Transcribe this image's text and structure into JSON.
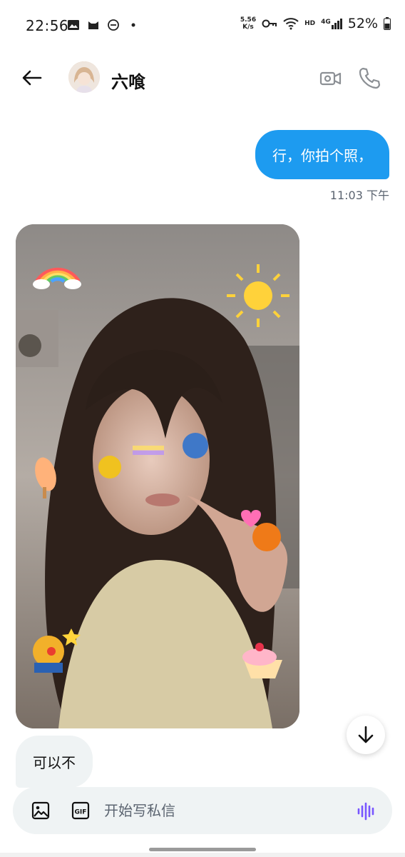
{
  "status_bar": {
    "time": "22:56",
    "net_speed_value": "5.56",
    "net_speed_unit": "K/s",
    "network_hd": "HD",
    "network_gen": "4G",
    "battery": "52%",
    "left_icons": [
      "image-icon",
      "cat-icon",
      "dnd-icon",
      "dot-icon"
    ],
    "right_icons": [
      "key-icon",
      "wifi-icon",
      "signal-icon",
      "battery-icon"
    ]
  },
  "header": {
    "contact_name": "六喰",
    "icons": [
      "back-arrow-icon",
      "video-call-icon",
      "phone-icon"
    ]
  },
  "conversation": {
    "outgoing_message": "行，你拍个照，",
    "outgoing_time": "11:03 下午",
    "incoming_message": "可以不"
  },
  "composer": {
    "placeholder": "开始写私信",
    "icons": [
      "image-icon",
      "gif-icon",
      "voice-icon"
    ],
    "gif_label": "GIF"
  },
  "colors": {
    "accent": "#1d9bf0",
    "incoming_bubble": "#eff3f4",
    "voice_icon": "#7856ff",
    "muted_text": "#5b6470"
  }
}
